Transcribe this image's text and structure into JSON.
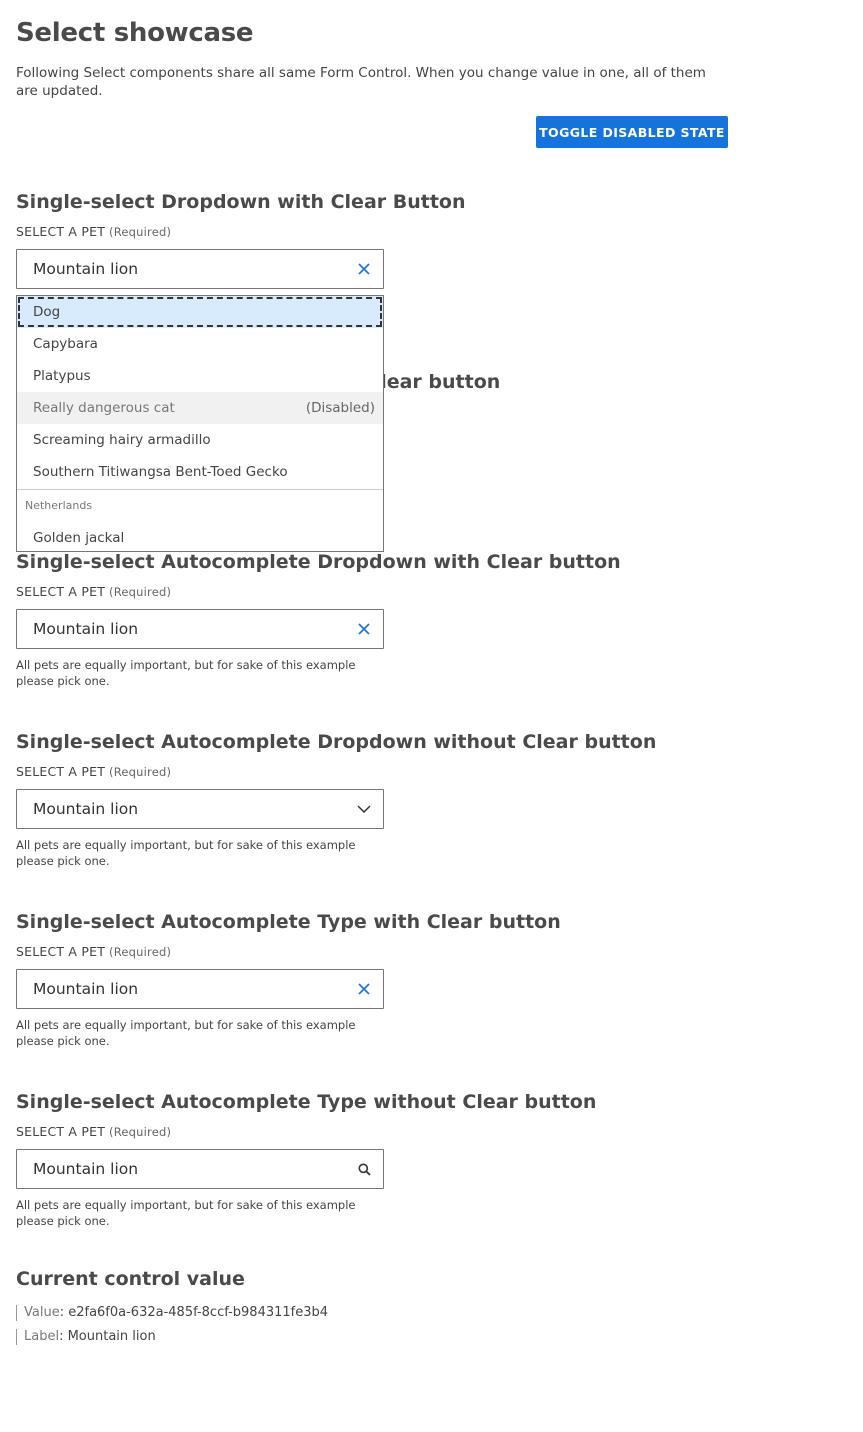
{
  "page": {
    "title": "Select showcase",
    "intro": "Following Select components share all same Form Control. When you change value in one, all of them are updated.",
    "toggle_label": "TOGGLE DISABLED STATE"
  },
  "field": {
    "label": "SELECT A PET",
    "required": "(Required)",
    "value": "Mountain lion",
    "hint": "All pets are equally important, but for sake of this example please pick one."
  },
  "sections": [
    {
      "title": "Single-select Dropdown with Clear Button",
      "icon": "close-icon"
    },
    {
      "title": "Single-select Dropdown without Clear button",
      "icon": "chevron-down-icon"
    },
    {
      "title": "Single-select Autocomplete Dropdown with Clear button",
      "icon": "close-icon"
    },
    {
      "title": "Single-select Autocomplete Dropdown without Clear button",
      "icon": "chevron-down-icon"
    },
    {
      "title": "Single-select Autocomplete Type with Clear button",
      "icon": "close-icon"
    },
    {
      "title": "Single-select Autocomplete Type without Clear button",
      "icon": "search-icon"
    }
  ],
  "dropdown": {
    "options": [
      {
        "label": "Dog",
        "state": "active"
      },
      {
        "label": "Capybara",
        "state": "normal"
      },
      {
        "label": "Platypus",
        "state": "normal"
      },
      {
        "label": "Really dangerous cat",
        "state": "disabled",
        "tag": "(Disabled)"
      },
      {
        "label": "Screaming hairy armadillo",
        "state": "normal"
      },
      {
        "label": "Southern Titiwangsa Bent-Toed Gecko",
        "state": "normal"
      }
    ],
    "group_label": "Netherlands",
    "group_options": [
      {
        "label": "Golden jackal"
      }
    ]
  },
  "current_value": {
    "title": "Current control value",
    "value_key": "Value",
    "value": "e2fa6f0a-632a-485f-8ccf-b984311fe3b4",
    "label_key": "Label",
    "label": "Mountain lion"
  },
  "colors": {
    "accent": "#1673dc",
    "active_option_bg": "#d8ebfd",
    "disabled_option_bg": "#f1f1f1"
  }
}
